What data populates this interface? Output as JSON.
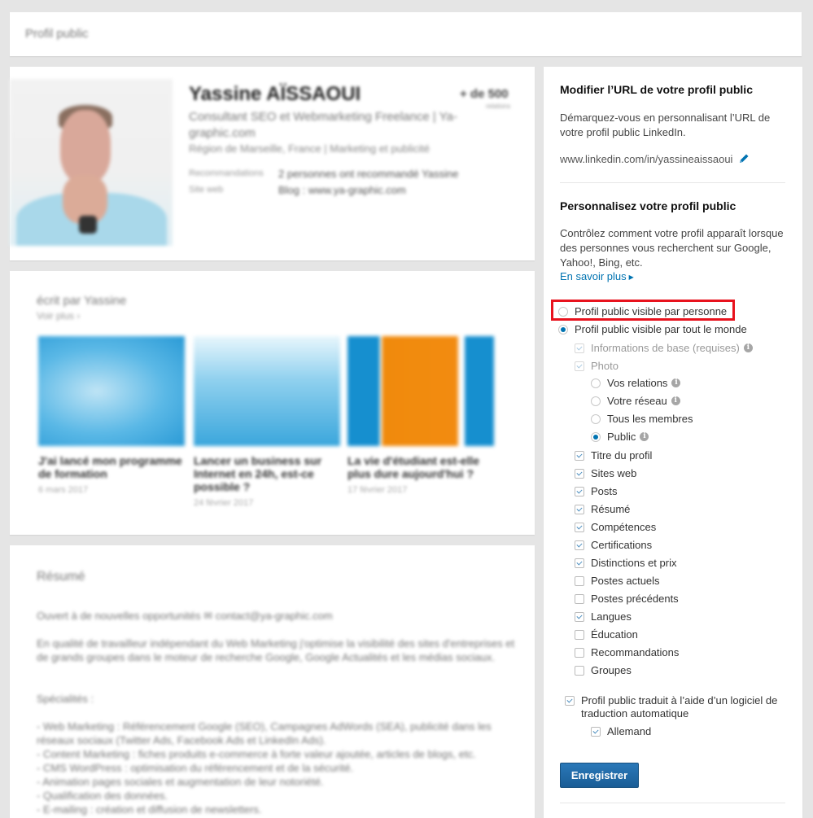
{
  "topbar": {
    "title": "Profil public"
  },
  "profile": {
    "name": "Yassine AÏSSAOUI",
    "connections": "+ de 500",
    "connections_sub": "relations",
    "headline": "Consultant SEO et Webmarketing Freelance | Ya-graphic.com",
    "location": "Région de Marseille, France | Marketing et publicité",
    "meta": [
      {
        "label": "Recommandations",
        "value": "2 personnes ont recommandé Yassine"
      },
      {
        "label": "Site web",
        "value": "Blog : www.ya-graphic.com"
      }
    ]
  },
  "posts": {
    "heading": "écrit par Yassine",
    "see_more": "Voir plus ›",
    "items": [
      {
        "title": "J'ai lancé mon programme de formation",
        "date": "6 mars 2017"
      },
      {
        "title": "Lancer un business sur Internet en 24h, est-ce possible ?",
        "date": "24 février 2017"
      },
      {
        "title": "La vie d'étudiant est-elle plus dure aujourd'hui ?",
        "date": "17 février 2017"
      }
    ]
  },
  "summary": {
    "heading": "Résumé",
    "paragraphs": [
      "Ouvert à de nouvelles opportunités ✉ contact@ya-graphic.com",
      "En qualité de travailleur indépendant du Web Marketing j'optimise la visibilité des sites d'entreprises et de grands groupes dans le moteur de recherche Google, Google Actualités et les médias sociaux.",
      "Spécialités :",
      "- Web Marketing : Référencement Google (SEO), Campagnes AdWords (SEA), publicité dans les réseaux sociaux (Twitter Ads, Facebook Ads et LinkedIn Ads).\n- Content Marketing : fiches produits e-commerce à forte valeur ajoutée, articles de blogs, etc.\n- CMS WordPress : optimisation du référencement et de la sécurité.\n- Animation pages sociales et augmentation de leur notoriété.\n- Qualification des données.\n- E-mailing : création et diffusion de newsletters."
    ]
  },
  "panel": {
    "url_section": {
      "title": "Modifier l’URL de votre profil public",
      "description": "Démarquez-vous en personnalisant l’URL de votre profil public LinkedIn.",
      "url": "www.linkedin.com/in/yassineaissaoui",
      "edit_icon": "pencil-icon"
    },
    "custom_section": {
      "title": "Personnalisez votre profil public",
      "description": "Contrôlez comment votre profil apparaît lorsque des personnes vous recherchent sur Google, Yahoo!, Bing, etc.",
      "learn_more": "En savoir plus",
      "visibility_options": [
        {
          "label": "Profil public visible par personne",
          "selected": false,
          "highlighted": true
        },
        {
          "label": "Profil public visible par tout le monde",
          "selected": true
        }
      ],
      "basic_info": {
        "label": "Informations de base (requises)",
        "checked": true,
        "disabled": true
      },
      "photo": {
        "label": "Photo",
        "checked": true,
        "disabled": true
      },
      "photo_options": [
        {
          "label": "Vos relations",
          "selected": false,
          "info": true
        },
        {
          "label": "Votre réseau",
          "selected": false,
          "info": true
        },
        {
          "label": "Tous les membres",
          "selected": false,
          "info": false
        },
        {
          "label": "Public",
          "selected": true,
          "info": true
        }
      ],
      "sections": [
        {
          "label": "Titre du profil",
          "checked": true
        },
        {
          "label": "Sites web",
          "checked": true
        },
        {
          "label": "Posts",
          "checked": true
        },
        {
          "label": "Résumé",
          "checked": true
        },
        {
          "label": "Compétences",
          "checked": true
        },
        {
          "label": "Certifications",
          "checked": true
        },
        {
          "label": "Distinctions et prix",
          "checked": true
        },
        {
          "label": "Postes actuels",
          "checked": false
        },
        {
          "label": "Postes précédents",
          "checked": false
        },
        {
          "label": "Langues",
          "checked": true
        },
        {
          "label": "Éducation",
          "checked": false
        },
        {
          "label": "Recommandations",
          "checked": false
        },
        {
          "label": "Groupes",
          "checked": false
        }
      ],
      "translation": {
        "label": "Profil public traduit à l’aide d’un logiciel de traduction automatique",
        "checked": true
      },
      "translation_languages": [
        {
          "label": "Allemand",
          "checked": true
        }
      ],
      "save_label": "Enregistrer"
    }
  },
  "colors": {
    "accent": "#0073b1",
    "button": "#1f68a6",
    "highlight": "#e8121d",
    "background": "#e5e5e5"
  }
}
